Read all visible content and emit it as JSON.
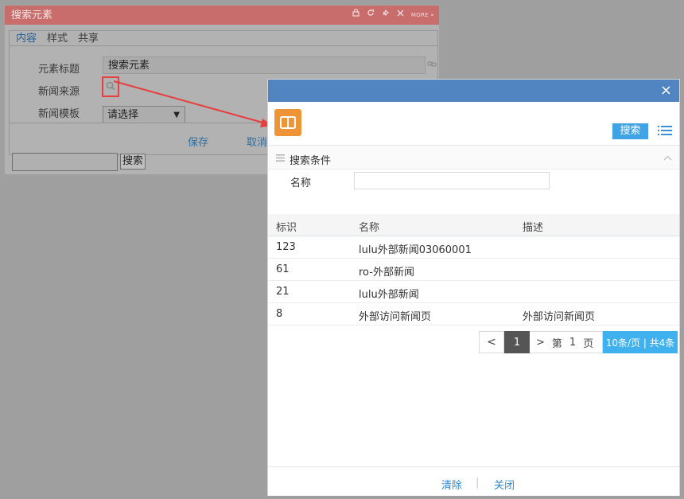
{
  "portlet": {
    "title": "搜索元素",
    "tools_more": "MORE",
    "tools_more_suffix": "»",
    "tabs": [
      "内容",
      "样式",
      "共享"
    ],
    "labels": {
      "title": "元素标题",
      "source": "新闻来源",
      "template": "新闻模板"
    },
    "title_value": "搜索元素",
    "template_select": "请选择",
    "save": "保存",
    "cancel": "取消",
    "bottom_search": "搜索"
  },
  "dialog": {
    "close": "×",
    "search_button": "搜索",
    "conditions_title": "搜索条件",
    "name_label": "名称",
    "name_value": "",
    "columns": [
      "标识",
      "名称",
      "描述"
    ],
    "rows": [
      {
        "id": "123",
        "name": "lulu外部新闻03060001",
        "desc": ""
      },
      {
        "id": "61",
        "name": "ro-外部新闻",
        "desc": ""
      },
      {
        "id": "21",
        "name": "lulu外部新闻",
        "desc": ""
      },
      {
        "id": "8",
        "name": "外部访问新闻页",
        "desc": "外部访问新闻页"
      }
    ],
    "pager": {
      "prev": "<",
      "current": "1",
      "next": ">",
      "page_prefix": "第",
      "page_number": "1",
      "page_suffix": "页",
      "summary": "10条/页 | 共4条"
    },
    "footer": {
      "clear": "清除",
      "separator": "|",
      "close": "关闭"
    }
  },
  "colors": {
    "portlet_header": "#c96c6c",
    "dialog_titlebar": "#5185c1",
    "accent_blue": "#3fa3e5",
    "app_icon": "#ef9436",
    "highlight_red": "#e83e3e"
  }
}
